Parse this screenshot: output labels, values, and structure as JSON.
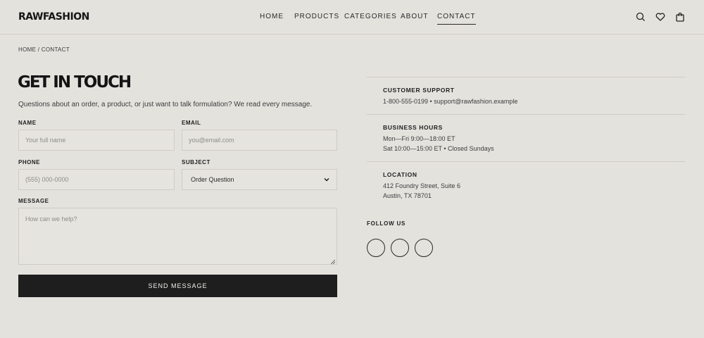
{
  "brand": {
    "logo": "RAWFASHION"
  },
  "nav": {
    "items": [
      {
        "label": "HOME"
      },
      {
        "label": "PRODUCTS"
      },
      {
        "label": "CATEGORIES"
      },
      {
        "label": "ABOUT"
      },
      {
        "label": "CONTACT",
        "active": true
      }
    ]
  },
  "header_icons": [
    "search-icon",
    "heart-icon",
    "cart-icon"
  ],
  "breadcrumb": "HOME / CONTACT",
  "page": {
    "title": "GET IN TOUCH",
    "intro": "Questions about an order, a product, or just want to talk formulation? We read every message."
  },
  "form": {
    "name": {
      "label": "NAME",
      "placeholder": "Your full name"
    },
    "email": {
      "label": "EMAIL",
      "placeholder": "you@email.com"
    },
    "phone": {
      "label": "PHONE",
      "placeholder": "(555) 000-0000"
    },
    "subject": {
      "label": "SUBJECT",
      "value": "Order Question"
    },
    "message": {
      "label": "MESSAGE",
      "placeholder": "How can we help?"
    },
    "submit_label": "SEND MESSAGE"
  },
  "info": {
    "support": {
      "heading": "CUSTOMER SUPPORT",
      "line1": "1-800-555-0199 • support@rawfashion.example"
    },
    "hours": {
      "heading": "BUSINESS HOURS",
      "line1": "Mon—Fri 9:00—18:00 ET",
      "line2": "Sat 10:00—15:00 ET • Closed Sundays"
    },
    "location": {
      "heading": "LOCATION",
      "line1": "412 Foundry Street, Suite 6",
      "line2": "Austin, TX 78701"
    }
  },
  "follow": {
    "heading": "FOLLOW US"
  },
  "colors": {
    "background": "#e4e2dd",
    "button": "#1e1e1e",
    "border": "#cfccc6"
  }
}
